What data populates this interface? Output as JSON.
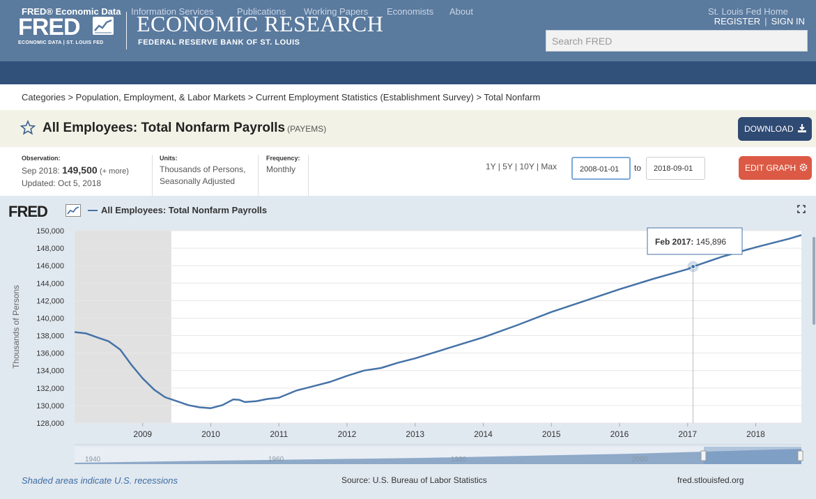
{
  "header": {
    "logo_text": "FRED",
    "logo_sub": "ECONOMIC DATA | ST. LOUIS FED",
    "title": "ECONOMIC RESEARCH",
    "subtitle": "FEDERAL RESERVE BANK OF ST. LOUIS",
    "register": "REGISTER",
    "sign_in": "SIGN IN",
    "search_placeholder": "Search FRED"
  },
  "nav": {
    "items": [
      "FRED® Economic Data",
      "Information Services",
      "Publications",
      "Working Papers",
      "Economists",
      "About"
    ],
    "right": "St. Louis Fed Home"
  },
  "breadcrumb": "Categories > Population, Employment, & Labor Markets > Current Employment Statistics (Establishment Survey) > Total Nonfarm",
  "series": {
    "title": "All Employees: Total Nonfarm Payrolls",
    "id": "(PAYEMS)",
    "download_label": "DOWNLOAD",
    "edit_label": "EDIT GRAPH"
  },
  "meta": {
    "observation_label": "Observation:",
    "observation_date": "Sep 2018:",
    "observation_value": "149,500",
    "more": "(+ more)",
    "updated": "Updated: Oct 5, 2018",
    "units_label": "Units:",
    "units_line1": "Thousands of Persons,",
    "units_line2": "Seasonally Adjusted",
    "frequency_label": "Frequency:",
    "frequency_value": "Monthly"
  },
  "range": {
    "links": "1Y | 5Y | 10Y | Max",
    "start": "2008-01-01",
    "to": "to",
    "end": "2018-09-01"
  },
  "graph": {
    "logo": "FRED",
    "legend": "All Employees: Total Nonfarm Payrolls",
    "tooltip_label": "Feb 2017:",
    "tooltip_value": "145,896"
  },
  "footer": {
    "note": "Shaded areas indicate U.S. recessions",
    "source": "Source: U.S. Bureau of Labor Statistics",
    "url": "fred.stlouisfed.org"
  },
  "navigator": {
    "labels": [
      "1940",
      "1960",
      "1980",
      "2000"
    ]
  },
  "colors": {
    "header": "#5a7a9e",
    "nav": "#31507a",
    "line": "#4572a7",
    "download": "#2f4a73",
    "edit": "#dc5a45"
  },
  "chart_data": {
    "type": "line",
    "title": "",
    "ylabel": "Thousands of Persons",
    "xlabel": "",
    "ylim": [
      128000,
      150000
    ],
    "xlim": [
      2008.0,
      2018.67
    ],
    "y_ticks": [
      "128,000",
      "130,000",
      "132,000",
      "134,000",
      "136,000",
      "138,000",
      "140,000",
      "142,000",
      "144,000",
      "146,000",
      "148,000",
      "150,000"
    ],
    "x_ticks": [
      "2009",
      "2010",
      "2011",
      "2012",
      "2013",
      "2014",
      "2015",
      "2016",
      "2017",
      "2018"
    ],
    "recession": [
      2008.0,
      2009.42
    ],
    "series": [
      {
        "name": "All Employees: Total Nonfarm Payrolls",
        "x": [
          2008.0,
          2008.17,
          2008.33,
          2008.5,
          2008.67,
          2008.83,
          2009.0,
          2009.17,
          2009.33,
          2009.5,
          2009.67,
          2009.83,
          2010.0,
          2010.17,
          2010.33,
          2010.42,
          2010.5,
          2010.67,
          2010.83,
          2011.0,
          2011.25,
          2011.5,
          2011.75,
          2012.0,
          2012.25,
          2012.5,
          2012.75,
          2013.0,
          2013.5,
          2014.0,
          2014.5,
          2015.0,
          2015.5,
          2016.0,
          2016.5,
          2017.0,
          2017.08,
          2017.5,
          2018.0,
          2018.5,
          2018.67
        ],
        "values": [
          138400,
          138250,
          137800,
          137350,
          136400,
          134700,
          133100,
          131800,
          130950,
          130500,
          130050,
          129800,
          129700,
          130050,
          130700,
          130650,
          130400,
          130500,
          130750,
          130900,
          131700,
          132200,
          132700,
          133400,
          134000,
          134300,
          134900,
          135400,
          136600,
          137800,
          139200,
          140700,
          142000,
          143300,
          144500,
          145600,
          145896,
          147000,
          148100,
          149100,
          149500
        ]
      }
    ]
  }
}
